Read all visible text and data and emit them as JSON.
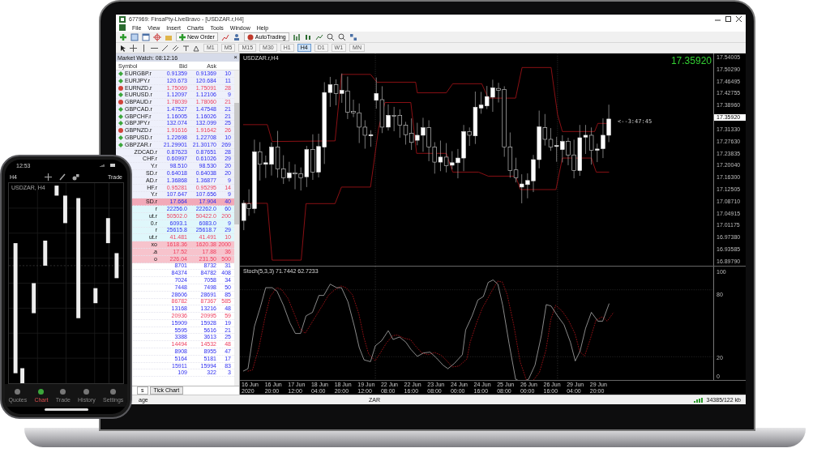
{
  "window": {
    "title": "677969: FinsaPty-LiveBravo - [USDZAR.r,H4]"
  },
  "menu": [
    "File",
    "View",
    "Insert",
    "Charts",
    "Tools",
    "Window",
    "Help"
  ],
  "toolbar": {
    "new_order": "New Order",
    "auto_trading": "AutoTrading"
  },
  "timeframes": [
    {
      "label": "M1",
      "selected": false
    },
    {
      "label": "M5",
      "selected": false
    },
    {
      "label": "M15",
      "selected": false
    },
    {
      "label": "M30",
      "selected": false
    },
    {
      "label": "H1",
      "selected": false
    },
    {
      "label": "H4",
      "selected": true
    },
    {
      "label": "D1",
      "selected": false
    },
    {
      "label": "W1",
      "selected": false
    },
    {
      "label": "MN",
      "selected": false
    }
  ],
  "market_watch": {
    "title": "Market Watch: 08:12:16",
    "close": "×",
    "columns": [
      "Symbol",
      "Bid",
      "Ask"
    ],
    "rows": [
      {
        "kind": "fx",
        "symbol": "EURGBP.r",
        "bid": "0.91359",
        "ask": "0.91369",
        "spread": "10",
        "up": true
      },
      {
        "kind": "fx",
        "symbol": "EURJPY.r",
        "bid": "120.673",
        "ask": "120.684",
        "spread": "11",
        "up": true
      },
      {
        "kind": "fx",
        "symbol": "EURNZD.r",
        "bid": "1.75069",
        "ask": "1.75091",
        "spread": "28",
        "up": false
      },
      {
        "kind": "fx",
        "symbol": "EURUSD.r",
        "bid": "1.12097",
        "ask": "1.12106",
        "spread": "9",
        "up": true
      },
      {
        "kind": "fx",
        "symbol": "GBPAUD.r",
        "bid": "1.78039",
        "ask": "1.78060",
        "spread": "21",
        "up": false
      },
      {
        "kind": "fx",
        "symbol": "GBPCAD.r",
        "bid": "1.47527",
        "ask": "1.47548",
        "spread": "21",
        "up": true
      },
      {
        "kind": "fx",
        "symbol": "GBPCHF.r",
        "bid": "1.16005",
        "ask": "1.16026",
        "spread": "21",
        "up": true
      },
      {
        "kind": "fx",
        "symbol": "GBPJPY.r",
        "bid": "132.074",
        "ask": "132.099",
        "spread": "25",
        "up": true
      },
      {
        "kind": "fx",
        "symbol": "GBPNZD.r",
        "bid": "1.91616",
        "ask": "1.91642",
        "spread": "26",
        "up": false
      },
      {
        "kind": "fx",
        "symbol": "GBPUSD.r",
        "bid": "1.22698",
        "ask": "1.22708",
        "spread": "10",
        "up": true
      },
      {
        "kind": "fx",
        "symbol": "GBPZAR.r",
        "bid": "21.29901",
        "ask": "21.30170",
        "spread": "269",
        "up": true
      },
      {
        "kind": "cut",
        "symbol": "ZDCAD.r",
        "bid": "0.87623",
        "ask": "0.87651",
        "spread": "28",
        "up": true
      },
      {
        "kind": "cut",
        "symbol": "CHF.r",
        "bid": "0.60997",
        "ask": "0.61026",
        "spread": "29",
        "up": true
      },
      {
        "kind": "cut",
        "symbol": "Y.r",
        "bid": "98.510",
        "ask": "98.530",
        "spread": "20",
        "up": true
      },
      {
        "kind": "cut",
        "symbol": "SD.r",
        "bid": "0.64018",
        "ask": "0.64038",
        "spread": "20",
        "up": true
      },
      {
        "kind": "cut",
        "symbol": "AD.r",
        "bid": "1.36868",
        "ask": "1.36877",
        "spread": "9",
        "up": true
      },
      {
        "kind": "cut",
        "symbol": "HF.r",
        "bid": "0.95281",
        "ask": "0.95295",
        "spread": "14",
        "up": false
      },
      {
        "kind": "cut",
        "symbol": "Y.r",
        "bid": "107.647",
        "ask": "107.656",
        "spread": "9",
        "up": true
      },
      {
        "kind": "selected",
        "symbol": "SD.r",
        "bid": "17.664",
        "ask": "17.904",
        "spread": "40",
        "up": true
      },
      {
        "kind": "index",
        "symbol": "r",
        "bid": "22256.0",
        "ask": "22262.0",
        "spread": "60",
        "up": true
      },
      {
        "kind": "index",
        "symbol": "ut.r",
        "bid": "50502.0",
        "ask": "50422.0",
        "spread": "200",
        "up": false
      },
      {
        "kind": "index",
        "symbol": "0.r",
        "bid": "6093.1",
        "ask": "6083.0",
        "spread": "9",
        "up": true
      },
      {
        "kind": "index",
        "symbol": "r",
        "bid": "25615.8",
        "ask": "25618.7",
        "spread": "29",
        "up": true
      },
      {
        "kind": "index",
        "symbol": "ut.r",
        "bid": "41.481",
        "ask": "41.491",
        "spread": "10",
        "up": false
      },
      {
        "kind": "metal",
        "symbol": "xo",
        "bid": "1618.36",
        "ask": "1620.38",
        "spread": "2000",
        "up": false
      },
      {
        "kind": "metal",
        "symbol": ".a",
        "bid": "17.52",
        "ask": "17.88",
        "spread": "36",
        "up": false
      },
      {
        "kind": "metal",
        "symbol": "o",
        "bid": "226.04",
        "ask": "231.50",
        "spread": "500",
        "up": false
      },
      {
        "kind": "plain",
        "bid": "8701",
        "ask": "8732",
        "spread": "31",
        "up": true
      },
      {
        "kind": "plain",
        "bid": "84374",
        "ask": "84782",
        "spread": "408",
        "up": true
      },
      {
        "kind": "plain",
        "bid": "7024",
        "ask": "7058",
        "spread": "34",
        "up": true
      },
      {
        "kind": "plain",
        "bid": "7448",
        "ask": "7498",
        "spread": "50",
        "up": true
      },
      {
        "kind": "plain",
        "bid": "28606",
        "ask": "28691",
        "spread": "85",
        "up": true
      },
      {
        "kind": "plain",
        "bid": "86782",
        "ask": "87367",
        "spread": "585",
        "up": false
      },
      {
        "kind": "plain",
        "bid": "13168",
        "ask": "13216",
        "spread": "48",
        "up": true
      },
      {
        "kind": "plain",
        "bid": "20936",
        "ask": "20995",
        "spread": "59",
        "up": false
      },
      {
        "kind": "plain",
        "bid": "15909",
        "ask": "15928",
        "spread": "19",
        "up": true
      },
      {
        "kind": "plain",
        "bid": "5595",
        "ask": "5616",
        "spread": "21",
        "up": true
      },
      {
        "kind": "plain",
        "bid": "3388",
        "ask": "3613",
        "spread": "25",
        "up": true
      },
      {
        "kind": "plain",
        "bid": "14494",
        "ask": "14532",
        "spread": "48",
        "up": false
      },
      {
        "kind": "plain",
        "bid": "8908",
        "ask": "8955",
        "spread": "47",
        "up": true
      },
      {
        "kind": "plain",
        "bid": "5164",
        "ask": "5181",
        "spread": "17",
        "up": true
      },
      {
        "kind": "plain",
        "bid": "15911",
        "ask": "15994",
        "spread": "83",
        "up": true
      },
      {
        "kind": "plain",
        "bid": "109",
        "ask": "322",
        "spread": "3",
        "up": true
      }
    ],
    "tabs": [
      {
        "label": "s",
        "selected": true
      },
      {
        "label": "Tick Chart",
        "selected": false
      }
    ]
  },
  "chart": {
    "label": "USDZAR.r,H4",
    "price": "17.35920",
    "countdown": "<--3:47:45",
    "indicator": "Stoch(5,3,3) 71.7442 62.7233",
    "price_axis": [
      {
        "label": "17.54005",
        "current": false
      },
      {
        "label": "17.50290",
        "current": false
      },
      {
        "label": "17.46495",
        "current": false
      },
      {
        "label": "17.42755",
        "current": false
      },
      {
        "label": "17.38960",
        "current": false
      },
      {
        "label": "17.35920",
        "current": true
      },
      {
        "label": "17.31330",
        "current": false
      },
      {
        "label": "17.27630",
        "current": false
      },
      {
        "label": "17.23835",
        "current": false
      },
      {
        "label": "17.20040",
        "current": false
      },
      {
        "label": "17.16300",
        "current": false
      },
      {
        "label": "17.12505",
        "current": false
      },
      {
        "label": "17.08710",
        "current": false
      },
      {
        "label": "17.04915",
        "current": false
      },
      {
        "label": "17.01175",
        "current": false
      },
      {
        "label": "16.97380",
        "current": false
      },
      {
        "label": "16.93585",
        "current": false
      },
      {
        "label": "16.89790",
        "current": false
      }
    ],
    "stoch_axis": [
      "100",
      "80",
      "20",
      "0"
    ],
    "time_axis": [
      "16 Jun 2020",
      "16 Jun 20:00",
      "17 Jun 12:00",
      "18 Jun 04:00",
      "18 Jun 20:00",
      "19 Jun 12:00",
      "22 Jun 08:00",
      "22 Jun 16:00",
      "23 Jun 08:00",
      "24 Jun 00:00",
      "24 Jun 16:00",
      "25 Jun 08:00",
      "26 Jun 00:00",
      "26 Jun 16:00",
      "29 Jun 04:00",
      "29 Jun 20:00"
    ]
  },
  "status_bar": {
    "left": "age",
    "middle": "ZAR",
    "right": "34385/122 kb"
  },
  "phone": {
    "time": "12:53",
    "timeframe": "H4",
    "trade": "Trade",
    "chart_label": "USDZAR, H4",
    "tabs": [
      {
        "label": "Quotes",
        "selected": false
      },
      {
        "label": "Chart",
        "selected": true
      },
      {
        "label": "Trade",
        "selected": false
      },
      {
        "label": "History",
        "selected": false
      },
      {
        "label": "Settings",
        "selected": false
      }
    ]
  }
}
